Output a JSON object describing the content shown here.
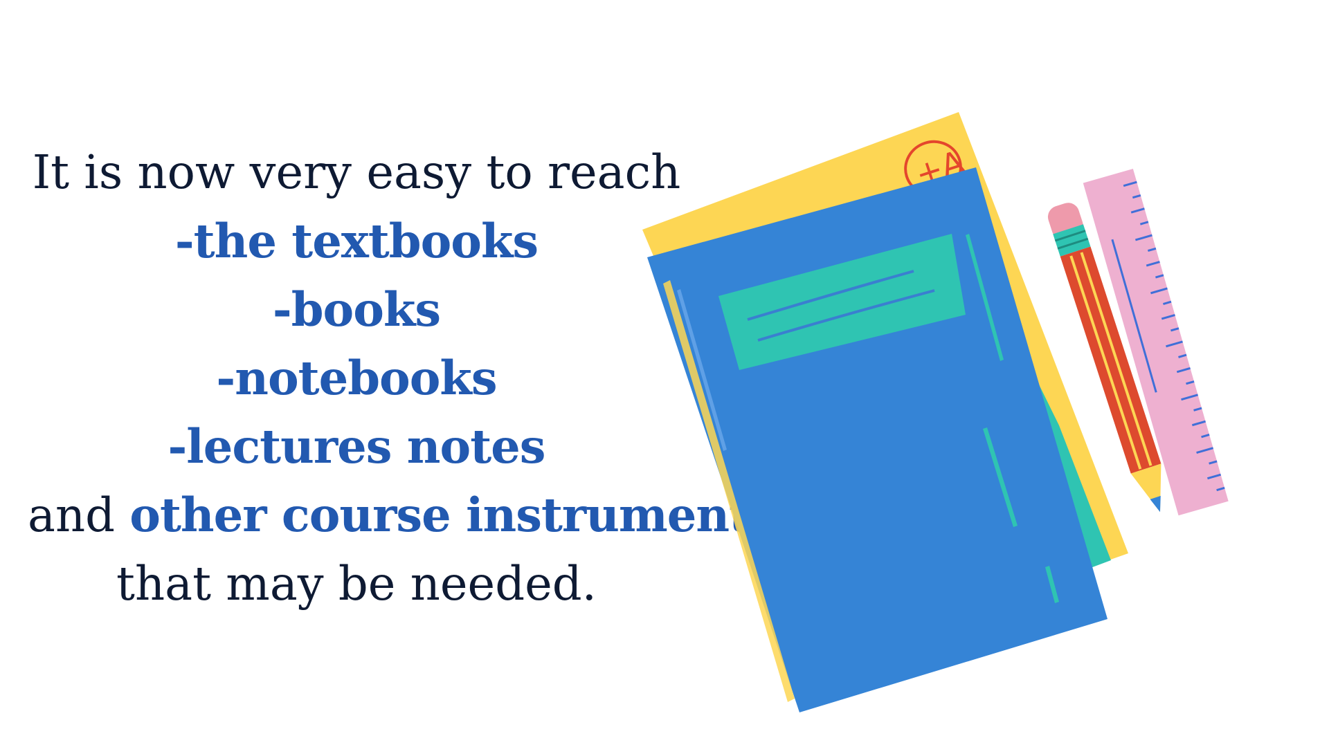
{
  "text": {
    "intro": "It is now very easy to reach",
    "items": [
      "-the textbooks",
      "-books",
      "-notebooks",
      "-lectures notes"
    ],
    "closing_prefix": "and ",
    "closing_highlight": "other course instruments",
    "closing_suffix": "that may be needed."
  },
  "illustration": {
    "grade_mark": "+A",
    "colors": {
      "book_blue": "#3584d6",
      "book_yellow": "#fdd654",
      "book_teal": "#2fc4b2",
      "pencil_red": "#dd4a2e",
      "pencil_eraser": "#ee9aab",
      "ruler_pink": "#eeb0d0",
      "accent_text": "#2259b0",
      "dark_text": "#0e1a33"
    },
    "icons": [
      "notebook-icon",
      "pencil-icon",
      "ruler-icon"
    ]
  }
}
